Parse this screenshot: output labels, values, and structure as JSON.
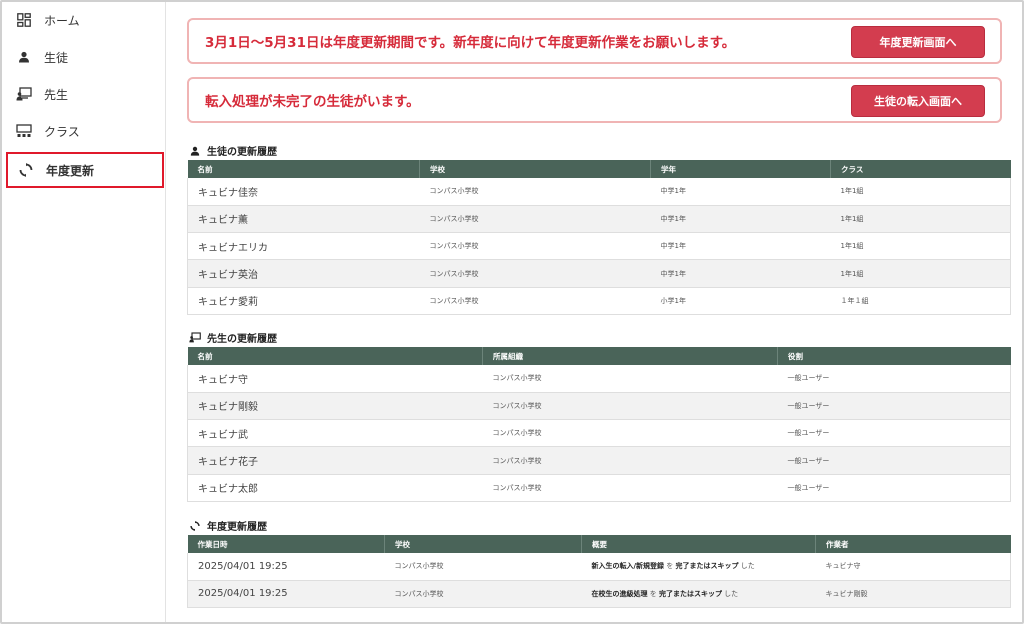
{
  "sidebar": {
    "items": [
      {
        "label": "ホーム",
        "icon": "dashboard-icon"
      },
      {
        "label": "生徒",
        "icon": "person-icon"
      },
      {
        "label": "先生",
        "icon": "teacher-icon"
      },
      {
        "label": "クラス",
        "icon": "classroom-icon"
      },
      {
        "label": "年度更新",
        "icon": "refresh-icon"
      }
    ]
  },
  "alerts": {
    "renewal": {
      "message": "3月1日〜5月31日は年度更新期間です。新年度に向けて年度更新作業をお願いします。",
      "button": "年度更新画面へ"
    },
    "transfer": {
      "message": "転入処理が未完了の生徒がいます。",
      "button": "生徒の転入画面へ"
    }
  },
  "students": {
    "title": "生徒の更新履歴",
    "headers": [
      "名前",
      "学校",
      "学年",
      "クラス"
    ],
    "rows": [
      [
        "キュビナ佳奈",
        "コンパス小学校",
        "中学1年",
        "1年1組"
      ],
      [
        "キュビナ薫",
        "コンパス小学校",
        "中学1年",
        "1年1組"
      ],
      [
        "キュビナエリカ",
        "コンパス小学校",
        "中学1年",
        "1年1組"
      ],
      [
        "キュビナ英治",
        "コンパス小学校",
        "中学1年",
        "1年1組"
      ],
      [
        "キュビナ愛莉",
        "コンパス小学校",
        "小学1年",
        "１年１組"
      ]
    ]
  },
  "teachers": {
    "title": "先生の更新履歴",
    "headers": [
      "名前",
      "所属組織",
      "役割"
    ],
    "rows": [
      [
        "キュビナ守",
        "コンパス小学校",
        "一般ユーザー"
      ],
      [
        "キュビナ剛毅",
        "コンパス小学校",
        "一般ユーザー"
      ],
      [
        "キュビナ武",
        "コンパス小学校",
        "一般ユーザー"
      ],
      [
        "キュビナ花子",
        "コンパス小学校",
        "一般ユーザー"
      ],
      [
        "キュビナ太郎",
        "コンパス小学校",
        "一般ユーザー"
      ]
    ]
  },
  "renewals": {
    "title": "年度更新履歴",
    "headers": [
      "作業日時",
      "学校",
      "概要",
      "作業者"
    ],
    "rows": [
      {
        "datetime": "2025/04/01 19:25",
        "school": "コンパス小学校",
        "summary_a": "新入生の転入/新規登録",
        "summary_mid": " を ",
        "summary_b": "完了またはスキップ",
        "summary_end": " した",
        "worker": "キュビナ守"
      },
      {
        "datetime": "2025/04/01 19:25",
        "school": "コンパス小学校",
        "summary_a": "在校生の進級処理",
        "summary_mid": " を ",
        "summary_b": "完了またはスキップ",
        "summary_end": " した",
        "worker": "キュビナ剛毅"
      }
    ]
  },
  "colors": {
    "accent": "#d33d4f",
    "table_header": "#4a6459",
    "highlight_border": "#e0192b"
  }
}
